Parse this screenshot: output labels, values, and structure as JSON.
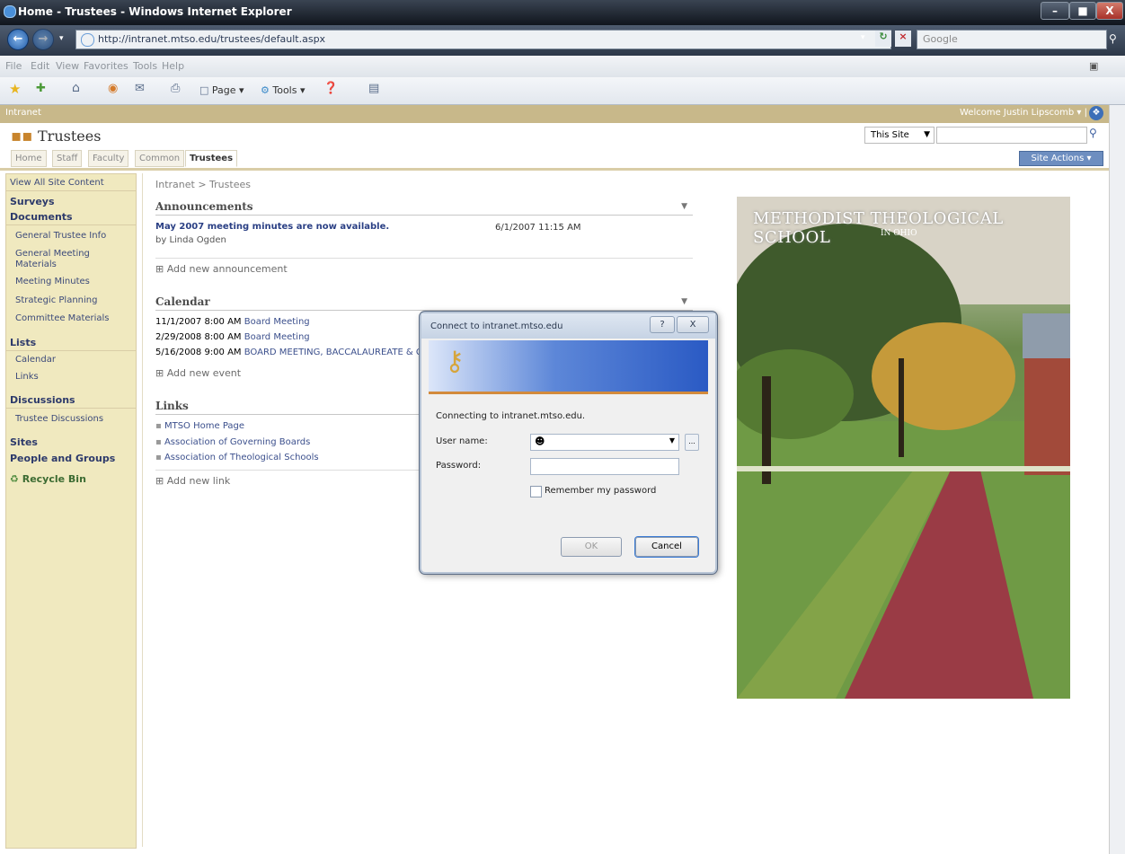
{
  "window": {
    "title": "Home - Trustees - Windows Internet Explorer",
    "minimize": "–",
    "maximize": "■",
    "close": "X"
  },
  "browser": {
    "address": "http://intranet.mtso.edu/trustees/default.aspx",
    "search_placeholder": "Google",
    "menu": [
      "File",
      "Edit",
      "View",
      "Favorites",
      "Tools",
      "Help"
    ],
    "toolbar": {
      "page_label": "Page ▾",
      "tools_label": "Tools ▾"
    }
  },
  "sharepoint": {
    "global_title": "Intranet",
    "welcome": "Welcome Justin Lipscomb ▾ |",
    "site_title": "Trustees",
    "search_scope": "This Site",
    "site_actions": "Site Actions ▾",
    "tabs": [
      "Home",
      "Staff",
      "Faculty",
      "Common",
      "Trustees"
    ],
    "active_tab": "Trustees",
    "breadcrumb": "Intranet > Trustees"
  },
  "leftnav": {
    "view_all": "View All Site Content",
    "surveys": "Surveys",
    "documents": "Documents",
    "doc_items": [
      "General Trustee Info",
      "General Meeting Materials",
      "Meeting Minutes",
      "Strategic Planning",
      "Committee Materials"
    ],
    "lists": "Lists",
    "list_items": [
      "Calendar",
      "Links"
    ],
    "discussions": "Discussions",
    "discussion_items": [
      "Trustee Discussions"
    ],
    "sites": "Sites",
    "people": "People and Groups",
    "recycle": "Recycle Bin"
  },
  "announcements": {
    "title": "Announcements",
    "item_title": "May 2007 meeting minutes are now available.",
    "item_date": "6/1/2007 11:15 AM",
    "item_by": "by Linda Ogden",
    "add": "Add new announcement"
  },
  "calendar": {
    "title": "Calendar",
    "events": [
      {
        "when": "11/1/2007 8:00 AM",
        "what": "Board Meeting"
      },
      {
        "when": "2/29/2008 8:00 AM",
        "what": "Board Meeting"
      },
      {
        "when": "5/16/2008 9:00 AM",
        "what": "BOARD MEETING, BACCALAUREATE & CO"
      }
    ],
    "add": "Add new event"
  },
  "links": {
    "title": "Links",
    "items": [
      "MTSO Home Page",
      "Association of Governing Boards",
      "Association of Theological Schools"
    ],
    "add": "Add new link"
  },
  "dialog": {
    "title": "Connect to intranet.mtso.edu",
    "help": "?",
    "close": "X",
    "message": "Connecting to intranet.mtso.edu.",
    "username_label": "User name:",
    "password_label": "Password:",
    "remember": "Remember my password",
    "ok": "OK",
    "cancel": "Cancel"
  },
  "photo": {
    "caption": "METHODIST THEOLOGICAL SCHOOL",
    "subcaption": "IN OHIO"
  }
}
